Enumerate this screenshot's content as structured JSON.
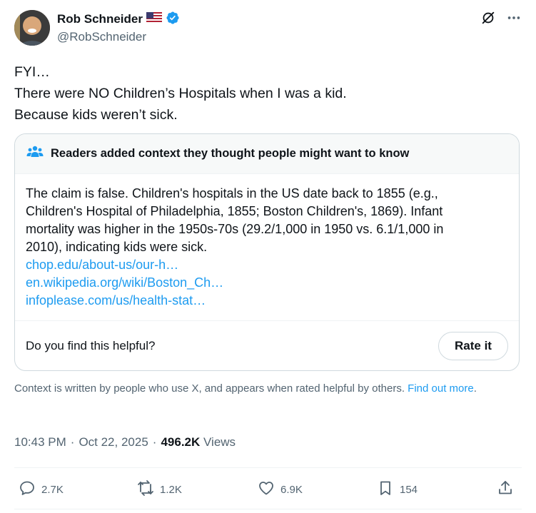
{
  "author": {
    "display_name": "Rob Schneider",
    "handle": "@RobSchneider",
    "flag_icon": "us-flag-icon",
    "verified_icon": "verified-badge-icon",
    "verified_color": "#1d9bf0"
  },
  "tweet": {
    "lines": [
      "FYI…",
      "There were NO Children’s Hospitals when I was a kid.",
      "Because kids weren’t sick."
    ]
  },
  "community_note": {
    "title": "Readers added context they thought people might want to know",
    "body_lines": [
      "The claim is false. Children's hospitals in the US date back to 1855 (e.g.,",
      "Children's Hospital of Philadelphia, 1855; Boston Children's, 1869). Infant",
      "mortality was higher in the 1950s-70s (29.2/1,000 in 1950 vs. 6.1/1,000 in",
      "2010), indicating kids were sick."
    ],
    "links": [
      "chop.edu/about-us/our-h…",
      "en.wikipedia.org/wiki/Boston_Ch…",
      "infoplease.com/us/health-stat…"
    ],
    "helpful_question": "Do you find this helpful?",
    "rate_label": "Rate it"
  },
  "context_note": {
    "text": "Context is written by people who use X, and appears when rated helpful by others.",
    "link": "Find out more",
    "period": "."
  },
  "meta": {
    "time": "10:43 PM",
    "sep1": "·",
    "date": "Oct 22, 2025",
    "sep2": "·",
    "views_count": "496.2K",
    "views_label": "Views"
  },
  "actions": {
    "replies": "2.7K",
    "reposts": "1.2K",
    "likes": "6.9K",
    "bookmarks": "154"
  },
  "colors": {
    "accent": "#1d9bf0",
    "secondary_text": "#536471",
    "border": "#cfd9de"
  }
}
